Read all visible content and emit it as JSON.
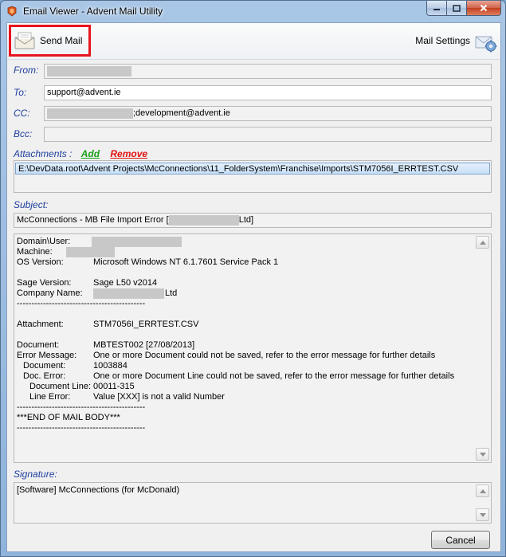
{
  "window": {
    "title": "Email Viewer - Advent Mail Utility"
  },
  "toolbar": {
    "send_label": "Send Mail",
    "settings_label": "Mail Settings"
  },
  "fields": {
    "from_label": "From:",
    "to_label": "To:",
    "to_value": "support@advent.ie",
    "cc_label": "CC:",
    "cc_value": ";development@advent.ie",
    "bcc_label": "Bcc:"
  },
  "attachments": {
    "label": "Attachments :",
    "add_label": "Add",
    "remove_label": "Remove",
    "items": [
      "E:\\DevData.root\\Advent Projects\\McConnections\\11_FolderSystem\\Franchise\\Imports\\STM7056I_ERRTEST.CSV"
    ]
  },
  "subject": {
    "label": "Subject:",
    "prefix": "McConnections - MB File Import Error [",
    "suffix": "Ltd]"
  },
  "body": {
    "domain_user": "Domain\\User:",
    "machine": "Machine:",
    "os_label": "OS Version:",
    "os_value": "Microsoft Windows NT 6.1.7601 Service Pack 1",
    "sage_label": "Sage Version:",
    "sage_value": "Sage L50 v2014",
    "company_label": "Company Name:",
    "company_suffix": "Ltd",
    "separator": "--------------------------------------------",
    "attachment_label": "Attachment:",
    "attachment_value": "STM7056I_ERRTEST.CSV",
    "document_label": "Document:",
    "document_value": "MBTEST002 [27/08/2013]",
    "error_label": "Error Message:",
    "error_value": "One or more Document could not be saved, refer to the error message for further details",
    "doc_label": "Document:",
    "doc_value": "1003884",
    "doc_error_label": "Doc. Error:",
    "doc_error_value": "One or more Document Line could not be saved, refer to the error message for further details",
    "doc_line_label": "Document Line:",
    "doc_line_value": "00011-315",
    "line_error_label": "Line Error:",
    "line_error_value": "Value [XXX] is not a valid Number",
    "end_marker": "***END OF MAIL BODY***"
  },
  "signature": {
    "label": "Signature:",
    "value": "[Software] McConnections (for McDonald)"
  },
  "footer": {
    "cancel_label": "Cancel"
  },
  "icons": {
    "app": "app-logo-icon",
    "send": "envelope-icon",
    "settings": "mail-settings-icon",
    "scroll_up": "scroll-up-arrow-icon",
    "scroll_down": "scroll-down-arrow-icon"
  }
}
